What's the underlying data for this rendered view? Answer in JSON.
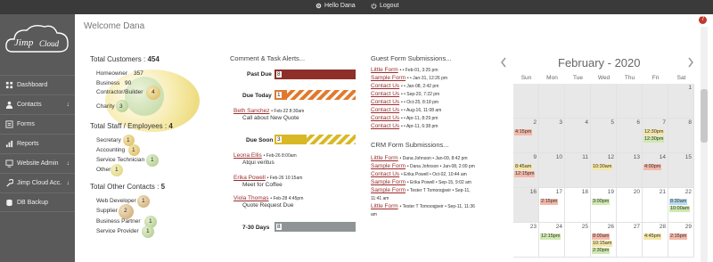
{
  "topbar": {
    "user_label": "Hello Dana",
    "logout_label": "Logout"
  },
  "notification": {
    "count": "7"
  },
  "logo": {
    "text": "Jimp·Cloud"
  },
  "sidebar": {
    "items": [
      {
        "label": "Dashboard",
        "icon": "dashboard-icon",
        "arrow": ""
      },
      {
        "label": "Contacts",
        "icon": "person-icon",
        "arrow": "↓"
      },
      {
        "label": "Forms",
        "icon": "list-icon",
        "arrow": ""
      },
      {
        "label": "Reports",
        "icon": "chart-icon",
        "arrow": ""
      },
      {
        "label": "Website Admin",
        "icon": "monitor-icon",
        "arrow": "↓"
      },
      {
        "label": "Jimp Cloud Acc.",
        "icon": "wrench-icon",
        "arrow": "↓"
      },
      {
        "label": "DB Backup",
        "icon": "database-icon",
        "arrow": ""
      }
    ]
  },
  "welcome": "Welcome Dana",
  "customers": {
    "title": "Total Customers : ",
    "total": "454",
    "items": [
      {
        "label": "Homeowner",
        "value": "357"
      },
      {
        "label": "Business",
        "value": "90"
      },
      {
        "label": "Contractor/Builder",
        "value": "4"
      },
      {
        "label": "Charity",
        "value": "3"
      }
    ]
  },
  "staff": {
    "title": "Total Staff / Employees : ",
    "total": "4",
    "items": [
      {
        "label": "Secretary",
        "value": "1"
      },
      {
        "label": "Accounting",
        "value": "1"
      },
      {
        "label": "Service Technician",
        "value": "1"
      },
      {
        "label": "Other",
        "value": "1"
      }
    ]
  },
  "other_contacts": {
    "title": "Total Other Contacts : ",
    "total": "5",
    "items": [
      {
        "label": "Web Developer",
        "value": "1"
      },
      {
        "label": "Supplier",
        "value": "2"
      },
      {
        "label": "Business Partner",
        "value": "1"
      },
      {
        "label": "Service Provider",
        "value": "1"
      }
    ]
  },
  "alerts": {
    "title": "Comment & Task Alerts...",
    "past_due": {
      "label": "Past Due",
      "count": "8",
      "color": "#8e2f2a"
    },
    "due_today": {
      "label": "Due Today",
      "count": "1",
      "color": "#e0792e"
    },
    "due_today_entry": {
      "name": "Beth Sanchez",
      "meta": "• Feb-22 8:30am",
      "text": "Call about New Quote"
    },
    "due_soon": {
      "label": "Due Soon",
      "count": "3",
      "color": "#d9b826"
    },
    "due_soon_entries": [
      {
        "name": "Leona Ellis",
        "meta": "• Feb-26 8:00am",
        "text": "Atqui veritus"
      },
      {
        "name": "Erika Powell",
        "meta": "• Feb-26 10:15am",
        "text": "Meet for Coffee"
      },
      {
        "name": "Viola Thomas",
        "meta": "• Feb-28 4:45pm",
        "text": "Quote Request Due"
      }
    ],
    "days_7_30": {
      "label": "7-30 Days",
      "count": "8",
      "color": "#8f9596"
    }
  },
  "guest_forms": {
    "title": "Guest Form Submissions...",
    "rows": [
      {
        "link": "Little Form",
        "meta": "• • Feb-01, 3:25 pm"
      },
      {
        "link": "Sample Form",
        "meta": "• • Jan-31, 12:26 pm"
      },
      {
        "link": "Contact Us",
        "meta": "• • Jan-08, 2:42 pm"
      },
      {
        "link": "Contact Us",
        "meta": "• • Sep-20, 7:22 pm"
      },
      {
        "link": "Contact Us",
        "meta": "• • Oct-25, 8:18 pm"
      },
      {
        "link": "Contact Us",
        "meta": "• • Aug-16, 11:08 am"
      },
      {
        "link": "Contact Us",
        "meta": "• • Apr-11, 8:29 pm"
      },
      {
        "link": "Contact Us",
        "meta": "• • Apr-11, 6:38 pm"
      }
    ]
  },
  "crm_forms": {
    "title": "CRM Form Submissions...",
    "rows": [
      {
        "link": "Little Form",
        "meta": "• Dana Johnson • Jan-09, 8:42 pm"
      },
      {
        "link": "Sample Form",
        "meta": "• Dana Johnson • Jan-08, 2:00 pm"
      },
      {
        "link": "Contact Us",
        "meta": "• Erika Powell • Oct-02, 10:44 am"
      },
      {
        "link": "Sample Form",
        "meta": "• Erika Powell • Sep-15, 9:02 am"
      },
      {
        "link": "Sample Form",
        "meta": "• Tester T Tomooqjseir • Sep-11,"
      },
      {
        "link": "",
        "meta": "11:41 am"
      },
      {
        "link": "Little Form",
        "meta": "• Tester T Tomooqjseir • Sep-11, 11:36"
      },
      {
        "link": "",
        "meta": "am"
      }
    ]
  },
  "calendar": {
    "title": "February - 2020",
    "days_of_week": [
      "Sun",
      "Mon",
      "Tue",
      "Wed",
      "Thu",
      "Fri",
      "Sat"
    ],
    "weeks": [
      [
        {
          "d": "",
          "g": true
        },
        {
          "d": "",
          "g": true
        },
        {
          "d": "",
          "g": true
        },
        {
          "d": "",
          "g": true
        },
        {
          "d": "",
          "g": true
        },
        {
          "d": "",
          "g": true
        },
        {
          "d": "1",
          "g": true
        }
      ],
      [
        {
          "d": "2",
          "g": true,
          "ev": [
            [
              "4:15pm",
              "red"
            ]
          ]
        },
        {
          "d": "3",
          "g": true
        },
        {
          "d": "4",
          "g": true
        },
        {
          "d": "5",
          "g": true
        },
        {
          "d": "6",
          "g": true
        },
        {
          "d": "7",
          "g": true,
          "ev": [
            [
              "12:30pm",
              "yellow"
            ],
            [
              "12:30pm",
              "green"
            ]
          ]
        },
        {
          "d": "8",
          "g": true
        }
      ],
      [
        {
          "d": "9",
          "g": true,
          "ev": [
            [
              "8:45am",
              "yellow"
            ],
            [
              "12:15pm",
              "red"
            ]
          ]
        },
        {
          "d": "10",
          "g": true
        },
        {
          "d": "11",
          "g": true
        },
        {
          "d": "12",
          "g": true,
          "ev": [
            [
              "10:30am",
              "yellow"
            ]
          ]
        },
        {
          "d": "13",
          "g": true
        },
        {
          "d": "14",
          "g": true,
          "ev": [
            [
              "4:00pm",
              "red"
            ]
          ]
        },
        {
          "d": "15",
          "g": true
        }
      ],
      [
        {
          "d": "16",
          "g": true
        },
        {
          "d": "17",
          "g": false,
          "ev": [
            [
              "2:15pm",
              "red"
            ]
          ]
        },
        {
          "d": "18",
          "g": false
        },
        {
          "d": "19",
          "g": false,
          "ev": [
            [
              "3:00pm",
              "green"
            ]
          ]
        },
        {
          "d": "20",
          "g": false
        },
        {
          "d": "21",
          "g": false
        },
        {
          "d": "22",
          "g": false,
          "ev": [
            [
              "8:30am",
              "blue"
            ],
            [
              "10:00am",
              "green"
            ]
          ]
        }
      ],
      [
        {
          "d": "23",
          "g": false
        },
        {
          "d": "24",
          "g": false,
          "ev": [
            [
              "12:15pm",
              "green"
            ]
          ]
        },
        {
          "d": "25",
          "g": false
        },
        {
          "d": "26",
          "g": false,
          "ev": [
            [
              "8:00am",
              "red"
            ],
            [
              "10:15am",
              "yellow"
            ],
            [
              "2:30pm",
              "green"
            ]
          ]
        },
        {
          "d": "27",
          "g": false
        },
        {
          "d": "28",
          "g": false,
          "ev": [
            [
              "4:45pm",
              "yellow"
            ]
          ]
        },
        {
          "d": "29",
          "g": false,
          "ev": [
            [
              "2:15pm",
              "red"
            ]
          ]
        }
      ]
    ]
  }
}
